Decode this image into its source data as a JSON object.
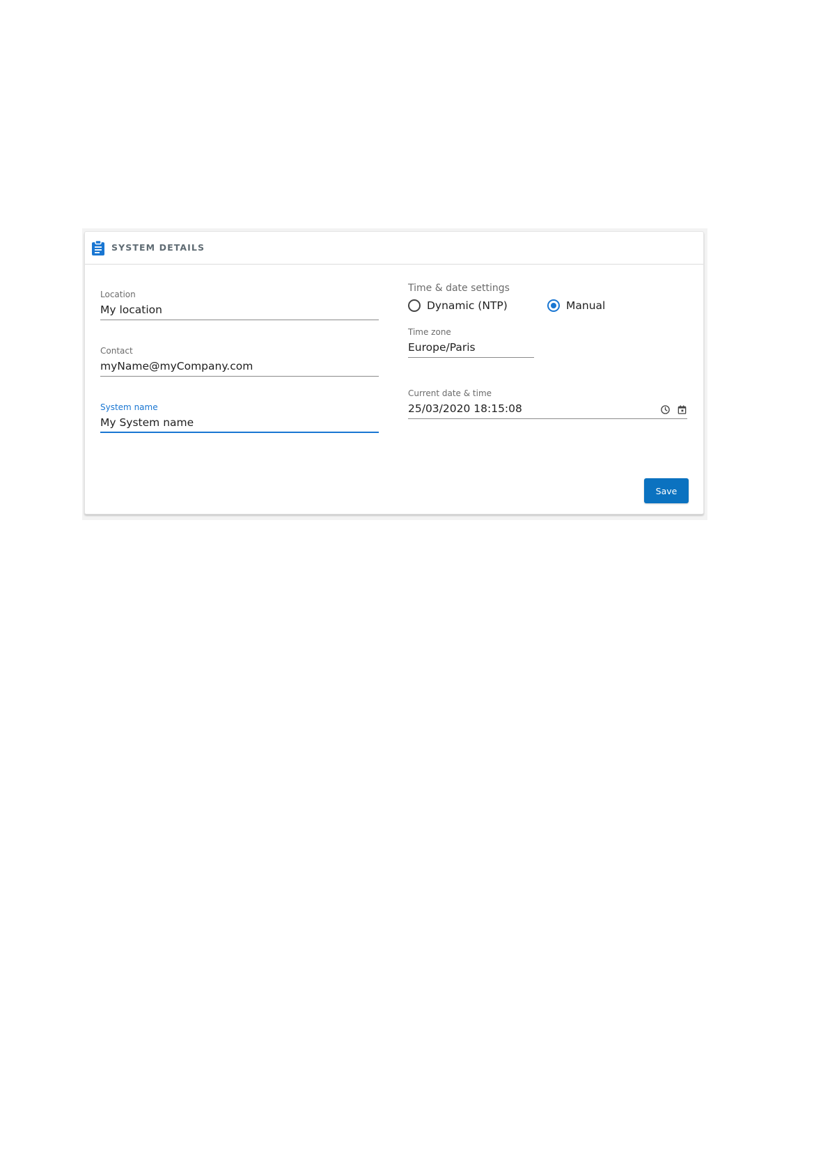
{
  "card": {
    "title": "SYSTEM DETAILS",
    "header_icon": "clipboard-icon"
  },
  "left_fields": {
    "location": {
      "label": "Location",
      "value": "My location"
    },
    "contact": {
      "label": "Contact",
      "value": "myName@myCompany.com"
    },
    "system_name": {
      "label": "System name",
      "value": "My System name",
      "focused": true
    }
  },
  "time_settings": {
    "group_label": "Time & date settings",
    "options": [
      {
        "label": "Dynamic (NTP)",
        "checked": false
      },
      {
        "label": "Manual",
        "checked": true
      }
    ],
    "time_zone": {
      "label": "Time zone",
      "value": "Europe/Paris"
    },
    "current_datetime": {
      "label": "Current date & time",
      "value": "25/03/2020 18:15:08"
    },
    "icons": [
      "clock-icon",
      "calendar-icon"
    ]
  },
  "actions": {
    "save_label": "Save"
  },
  "colors": {
    "accent": "#1976d2",
    "button": "#0b72c0",
    "label": "#6b6b6b",
    "header_text": "#5f6b73"
  }
}
